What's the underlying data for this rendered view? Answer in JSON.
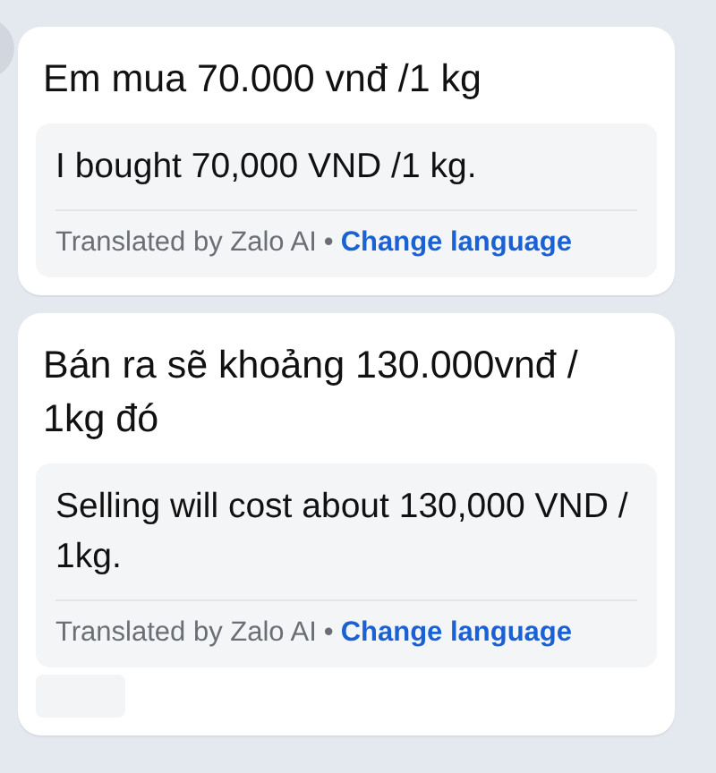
{
  "messages": [
    {
      "text": "Em mua 70.000 vnđ /1 kg",
      "translation": "I bought 70,000 VND /1 kg.",
      "attribution": "Translated by Zalo AI",
      "separator": "•",
      "action": "Change language",
      "reaction": false
    },
    {
      "text": "Bán ra sẽ khoảng 130.000vnđ / 1kg đó",
      "translation": "Selling will cost about 130,000 VND / 1kg.",
      "attribution": "Translated by Zalo AI",
      "separator": "•",
      "action": "Change language",
      "reaction": true
    }
  ]
}
